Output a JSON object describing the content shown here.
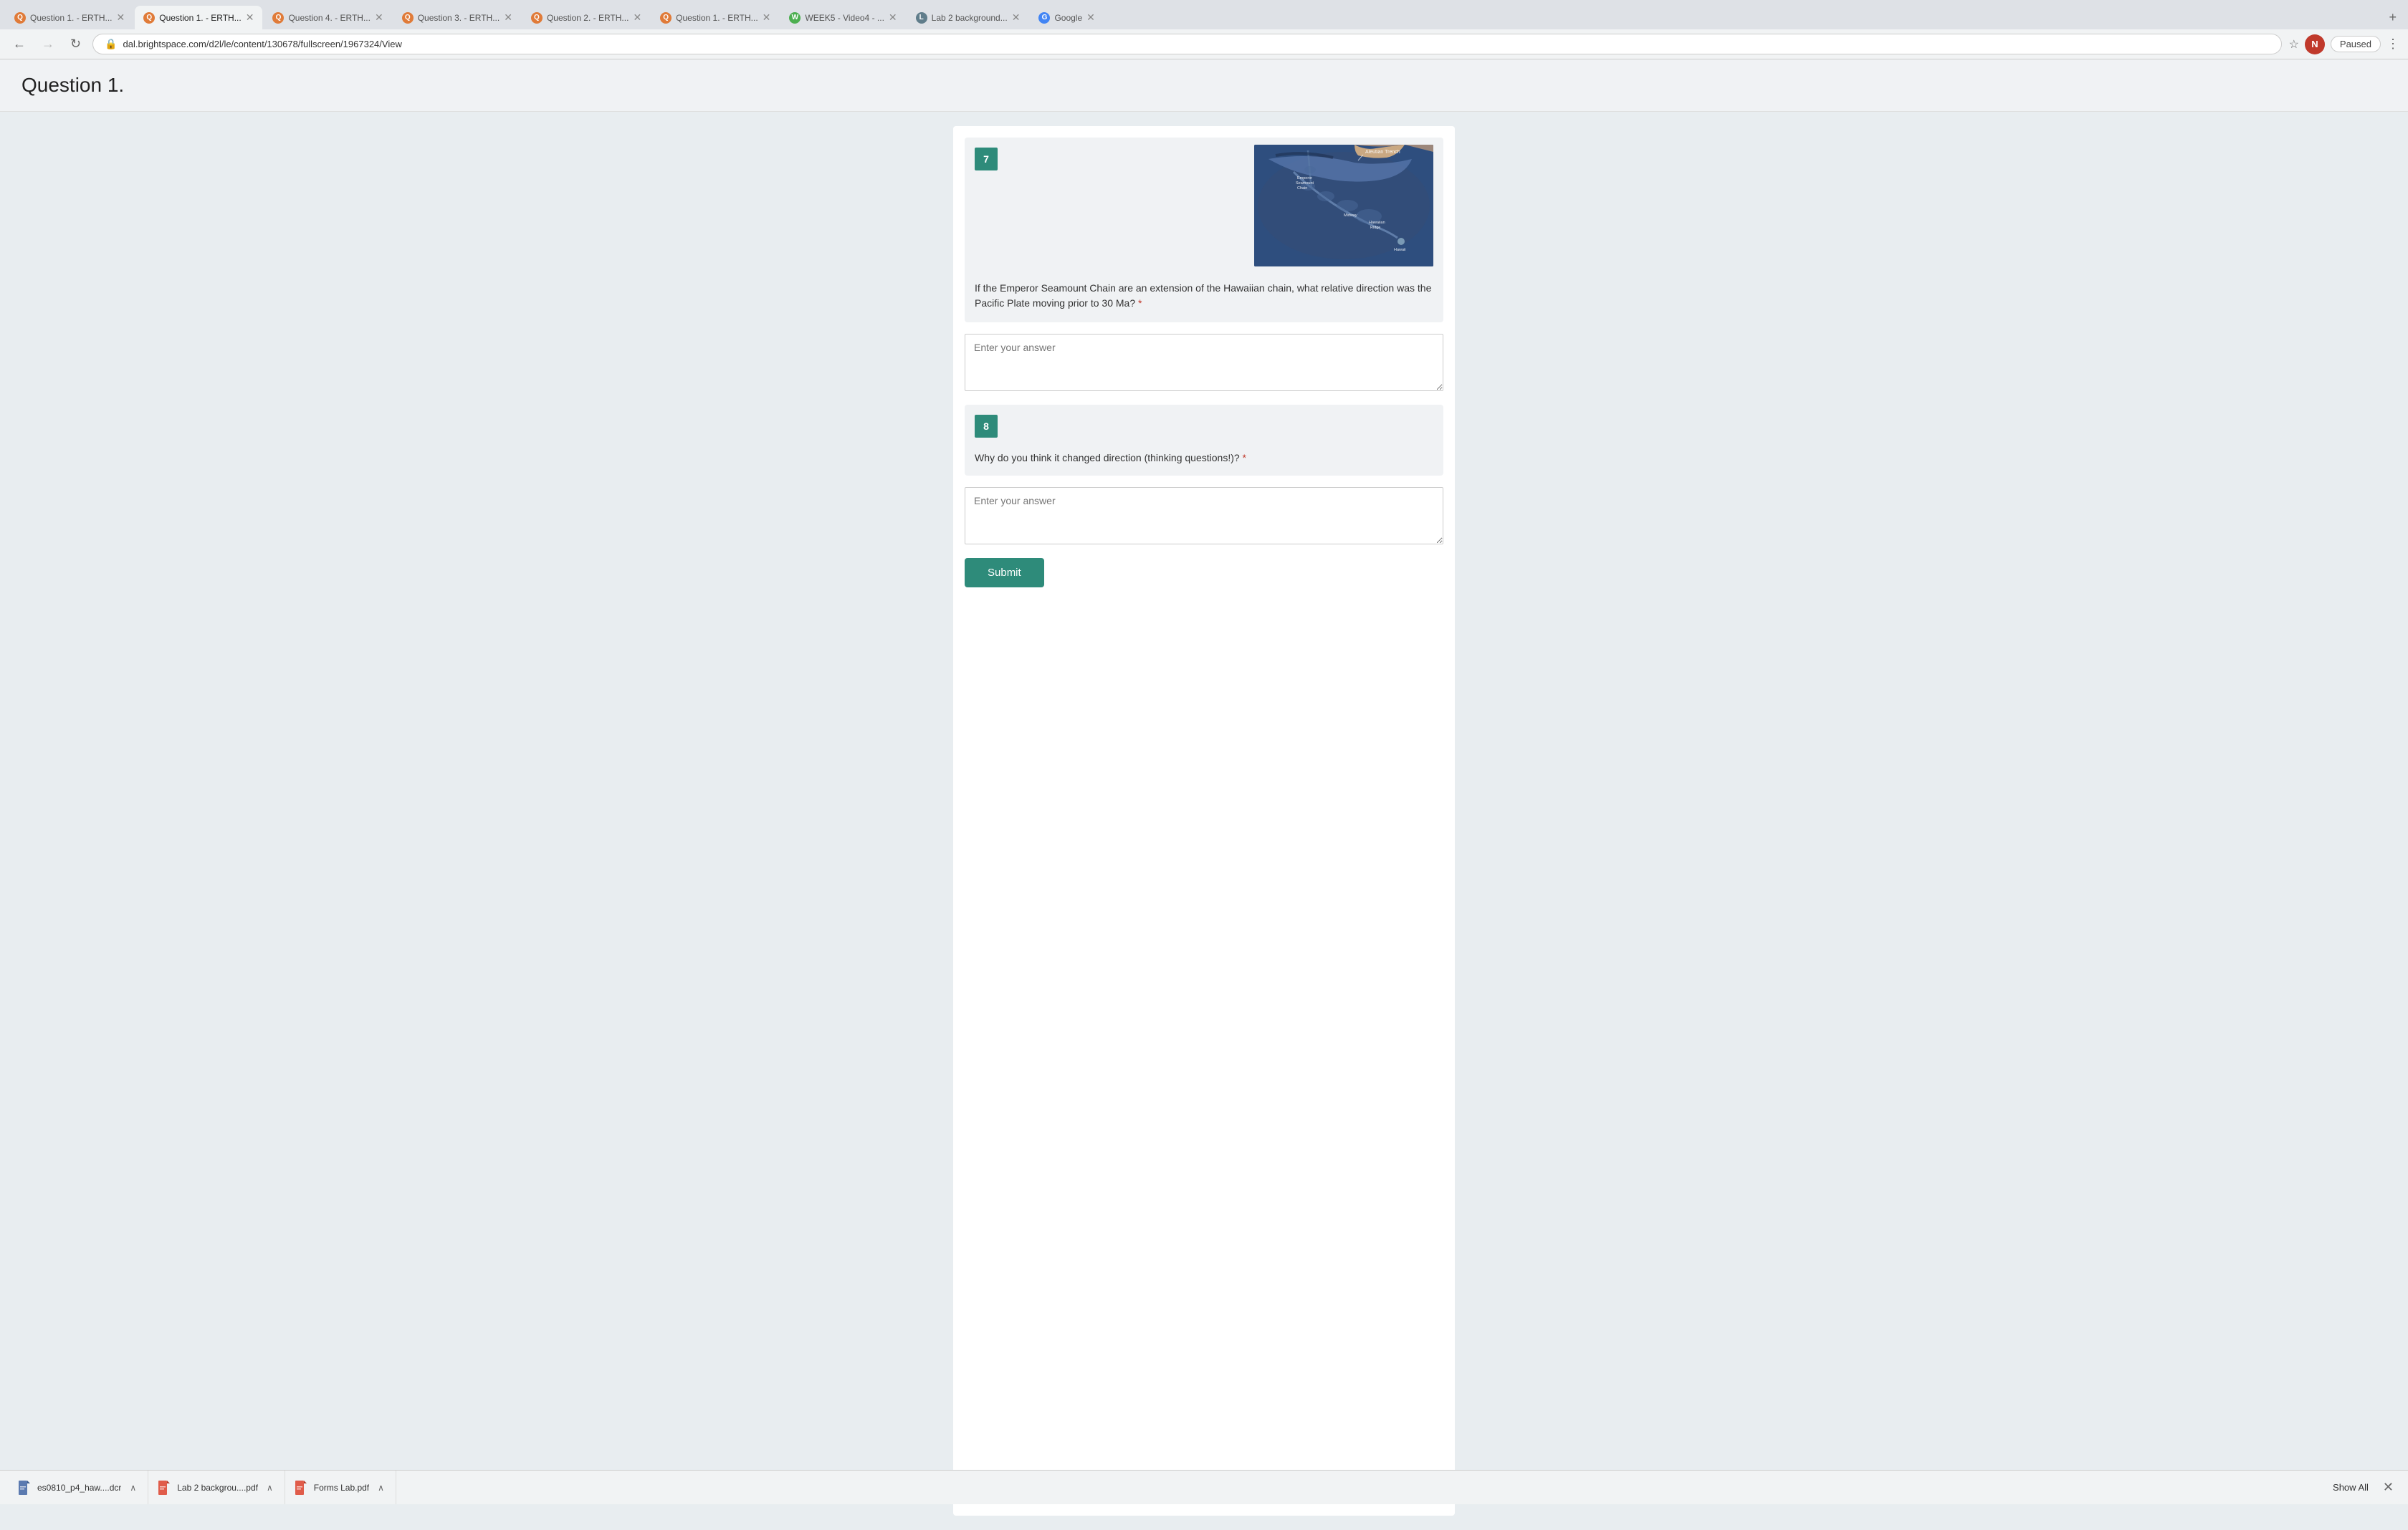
{
  "browser": {
    "tabs": [
      {
        "id": "tab1",
        "label": "Question 1. - ERTH...",
        "favicon_color": "#e07b39",
        "active": false
      },
      {
        "id": "tab2",
        "label": "Question 1. - ERTH...",
        "favicon_color": "#e07b39",
        "active": true
      },
      {
        "id": "tab3",
        "label": "Question 4. - ERTH...",
        "favicon_color": "#e07b39",
        "active": false
      },
      {
        "id": "tab4",
        "label": "Question 3. - ERTH...",
        "favicon_color": "#e07b39",
        "active": false
      },
      {
        "id": "tab5",
        "label": "Question 2. - ERTH...",
        "favicon_color": "#e07b39",
        "active": false
      },
      {
        "id": "tab6",
        "label": "Question 1. - ERTH...",
        "favicon_color": "#e07b39",
        "active": false
      },
      {
        "id": "tab7",
        "label": "WEEK5 - Video4 - ...",
        "favicon_color": "#4caf50",
        "active": false
      },
      {
        "id": "tab8",
        "label": "Lab 2 background...",
        "favicon_color": "#607d8b",
        "active": false
      },
      {
        "id": "tab9",
        "label": "Google",
        "favicon_color": "#4285f4",
        "active": false
      }
    ],
    "address": "dal.brightspace.com/d2l/le/content/130678/fullscreen/1967324/View",
    "profile_initial": "N",
    "paused_label": "Paused"
  },
  "page": {
    "title": "Question 1."
  },
  "question7": {
    "number": "7",
    "text": "If the Emperor Seamount Chain are an extension of the Hawaiian chain, what relative direction was the Pacific Plate moving prior to 30 Ma?",
    "placeholder": "Enter your answer"
  },
  "question8": {
    "number": "8",
    "text": "Why do you think it changed direction (thinking questions!)?",
    "placeholder": "Enter your answer"
  },
  "submit": {
    "label": "Submit"
  },
  "map": {
    "labels": [
      "Aleutian Trench",
      "Emperor Seamount Chain",
      "Midway",
      "Hawaiian Ridge",
      "Hawaii"
    ]
  },
  "downloads": {
    "items": [
      {
        "name": "es0810_p4_haw....dcr",
        "icon": "📄"
      },
      {
        "name": "Lab 2 backgrou....pdf",
        "icon": "📋"
      },
      {
        "name": "Forms Lab.pdf",
        "icon": "📋"
      }
    ],
    "show_all_label": "Show All"
  }
}
